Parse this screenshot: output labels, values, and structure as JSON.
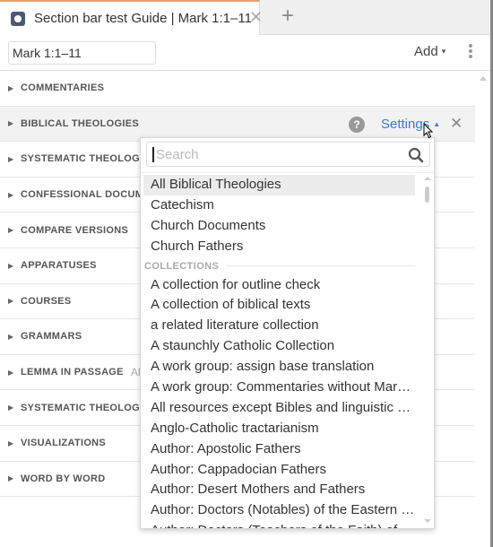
{
  "tab": {
    "title": "Section bar test Guide | Mark 1:1–11",
    "close_label": "✕",
    "new_tab_label": "+",
    "icon": "guide-icon"
  },
  "toolbar": {
    "reference_value": "Mark 1:1–11",
    "add_label": "Add",
    "add_caret": "▾"
  },
  "sections": [
    {
      "label": "COMMENTARIES",
      "sub": ""
    },
    {
      "label": "BIBLICAL THEOLOGIES",
      "sub": "",
      "active": true
    },
    {
      "label": "SYSTEMATIC THEOLOGIES",
      "sub": ""
    },
    {
      "label": "CONFESSIONAL DOCUMENTS",
      "sub": ""
    },
    {
      "label": "COMPARE VERSIONS",
      "sub": ""
    },
    {
      "label": "APPARATUSES",
      "sub": ""
    },
    {
      "label": "COURSES",
      "sub": ""
    },
    {
      "label": "GRAMMARS",
      "sub": ""
    },
    {
      "label": "LEMMA IN PASSAGE",
      "sub": "All"
    },
    {
      "label": "SYSTEMATIC THEOLOGIES",
      "sub": ""
    },
    {
      "label": "VISUALIZATIONS",
      "sub": ""
    },
    {
      "label": "WORD BY WORD",
      "sub": ""
    }
  ],
  "active_section_controls": {
    "help_label": "?",
    "settings_label": "Settings",
    "settings_caret": "▲",
    "close_label": "✕"
  },
  "dropdown": {
    "search_placeholder": "Search",
    "search_value": "",
    "top_items": [
      "All Biblical Theologies",
      "Catechism",
      "Church Documents",
      "Church Fathers"
    ],
    "selected_item": "All Biblical Theologies",
    "group_label": "COLLECTIONS",
    "collection_items": [
      "A collection for outline check",
      "A collection of biblical texts",
      "a related literature collection",
      "A staunchly Catholic Collection",
      "A work group: assign base translation",
      "A work group: Commentaries without Mark…",
      "All resources except Bibles and linguistic res…",
      "Anglo-Catholic tractarianism",
      "Author: Apostolic Fathers",
      "Author: Cappadocian Fathers",
      "Author: Desert Mothers and Fathers",
      "Author: Doctors (Notables) of the Eastern Or…",
      "Author: Doctors (Teachers of the Faith) of the…"
    ]
  },
  "colors": {
    "accent_link": "#3a7bd5",
    "tab_top_border": "#e8a070",
    "tab_icon": "#4a5a78",
    "active_row_bg": "#f2f2f2"
  }
}
